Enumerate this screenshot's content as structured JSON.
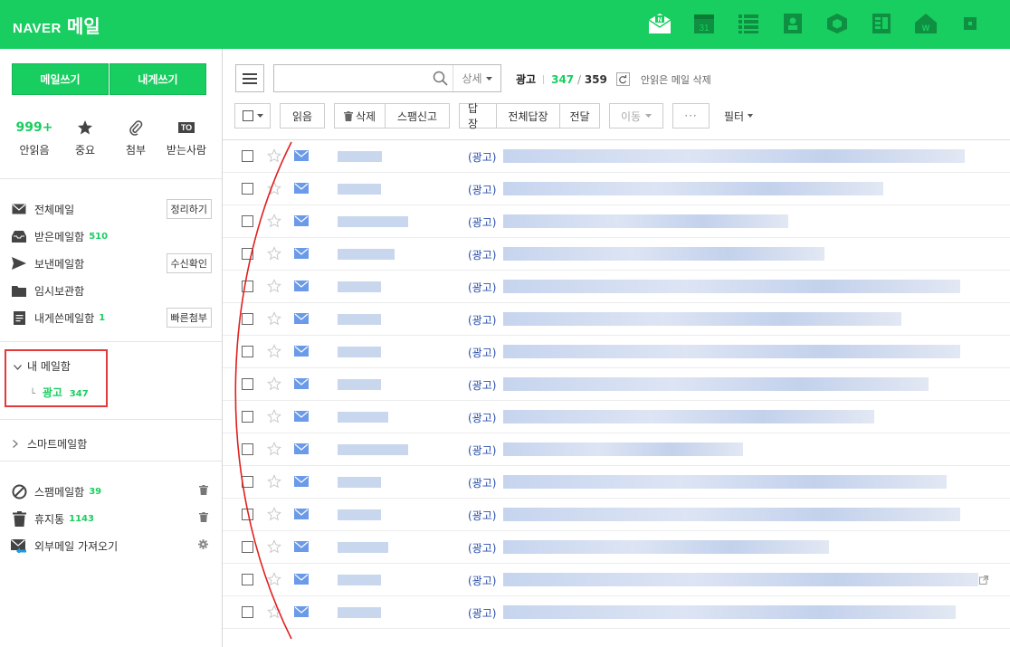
{
  "brand": {
    "logo": "NAVER",
    "title": "메일"
  },
  "top_icons": [
    "mail-app-icon",
    "calendar-icon",
    "list-icon",
    "contacts-icon",
    "box-icon",
    "memo-icon",
    "home-icon",
    "more-icon"
  ],
  "calendar_day": "31",
  "sidebar": {
    "write_button": "메일쓰기",
    "self_write_button": "내게쓰기",
    "quick": [
      {
        "value": "999+",
        "label": "안읽음"
      },
      {
        "icon": "star-icon",
        "label": "중요"
      },
      {
        "icon": "paperclip-icon",
        "label": "첨부"
      },
      {
        "icon": "to-icon",
        "badge": "TO",
        "label": "받는사람"
      }
    ],
    "folders": [
      {
        "label": "전체메일",
        "button": "정리하기"
      },
      {
        "label": "받은메일함",
        "count": "510"
      },
      {
        "label": "보낸메일함",
        "button": "수신확인"
      },
      {
        "label": "임시보관함"
      },
      {
        "label": "내게쓴메일함",
        "count": "1",
        "button": "빠른첨부"
      }
    ],
    "my_mailbox": {
      "label": "내 메일함",
      "sub_label": "광고",
      "sub_count": "347"
    },
    "smart_mailbox": "스마트메일함",
    "bottom_folders": [
      {
        "label": "스팸메일함",
        "count": "39"
      },
      {
        "label": "휴지통",
        "count": "1143"
      },
      {
        "label": "외부메일 가져오기"
      }
    ]
  },
  "main": {
    "search_placeholder": "",
    "search_detail": "상세",
    "folder_name": "광고",
    "unread_count": "347",
    "total_count": "359",
    "delete_unread": "안읽은 메일 삭제",
    "toolbar": {
      "read": "읽음",
      "delete": "삭제",
      "spam": "스팸신고",
      "reply": "답장",
      "reply_all": "전체답장",
      "forward": "전달",
      "move": "이동",
      "more": "···",
      "filter": "필터"
    },
    "ad_tag": "(광고)",
    "rows": [
      {
        "tag": "(광고)"
      },
      {
        "tag": "(광고)"
      },
      {
        "tag": "(광고)"
      },
      {
        "tag": "(광고)"
      },
      {
        "tag": "(광고)"
      },
      {
        "tag": "(광고)"
      },
      {
        "tag": "(광고)"
      },
      {
        "tag": "(광고)"
      },
      {
        "tag": "(광고)"
      },
      {
        "tag": "(광고)"
      },
      {
        "tag": "(광고)"
      },
      {
        "tag": "(광고)"
      },
      {
        "tag": "(광고)"
      },
      {
        "tag": "(광고)"
      },
      {
        "tag": "(광고)"
      }
    ]
  },
  "colors": {
    "brand_green": "#19ce60",
    "ad_tag_blue": "#2a4fa8",
    "highlight_red": "#e03a3a"
  }
}
